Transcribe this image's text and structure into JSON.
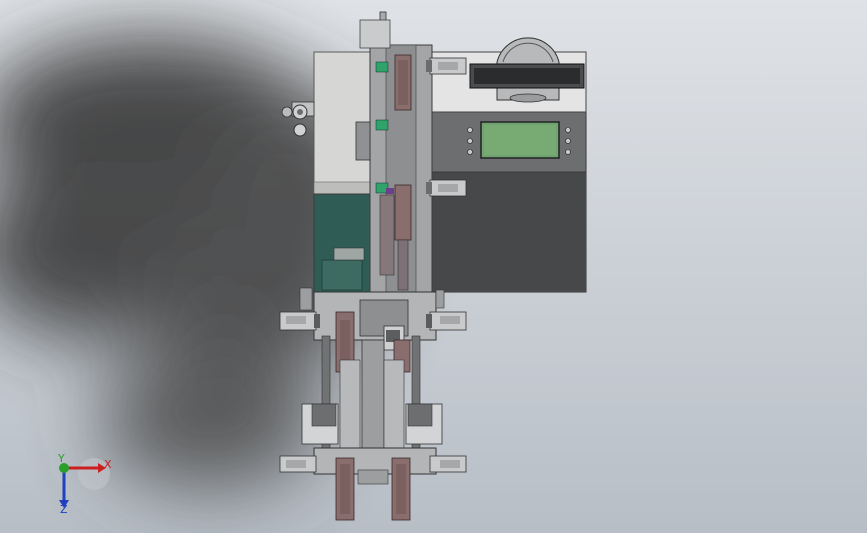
{
  "viewport": {
    "background_top": "#d9dde2",
    "background_bottom": "#b9c0c8",
    "shadow_color": "#3a3a3a"
  },
  "model": {
    "frame_color": "#9ea0a2",
    "panel_color": "#d4d4d2",
    "cabinet_color": "#6d6f71",
    "cabinet_dark": "#464849",
    "green_panel_color": "#2f5d55",
    "screen_color": "#6fa36f",
    "slide_color": "#8a6e6e",
    "accent_green": "#2fa36a",
    "accent_purple": "#6c3f8c"
  },
  "triad": {
    "x_label": "X",
    "y_label": "Y",
    "z_label": "Z",
    "x_color": "#cc2020",
    "y_color": "#2aa02a",
    "z_color": "#2040c0"
  }
}
